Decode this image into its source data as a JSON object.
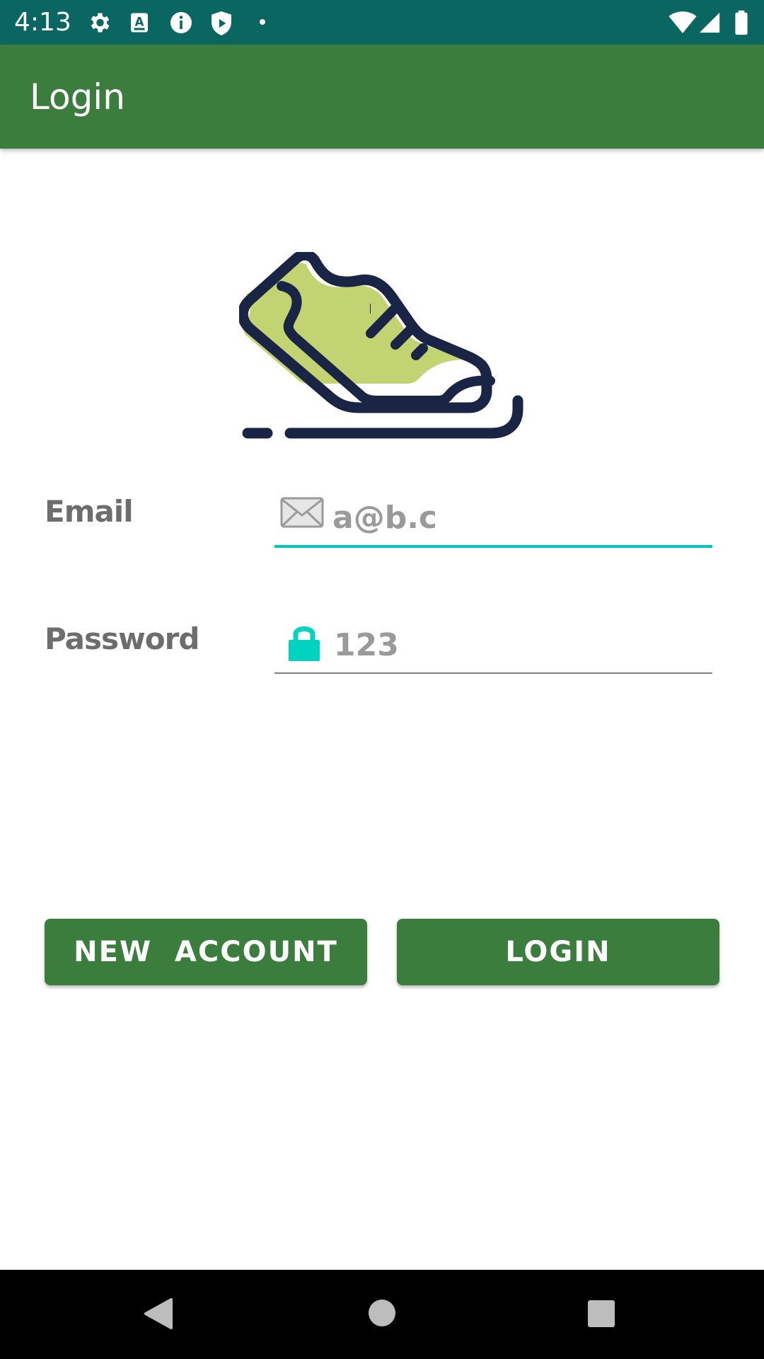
{
  "status_bar": {
    "time": "4:13",
    "background": "#0a6660",
    "left_icons": [
      "gear-icon",
      "translate-a-icon",
      "info-icon",
      "shield-play-icon",
      "dot-icon"
    ],
    "right_icons": [
      "wifi-icon",
      "cell-signal-icon",
      "battery-icon"
    ]
  },
  "app_bar": {
    "title": "Login",
    "background": "#3a7d3c"
  },
  "logo": {
    "icon": "sneaker-icon",
    "colors": {
      "outline": "#1a2545",
      "fill": "#c2d471"
    }
  },
  "form": {
    "email": {
      "label": "Email",
      "value": "a@b.c",
      "icon": "envelope-icon",
      "underline_color": "#00c4bd"
    },
    "password": {
      "label": "Password",
      "value": "123",
      "icon": "lock-icon",
      "icon_color": "#00d4c0",
      "underline_color": "#808080"
    }
  },
  "buttons": {
    "new_account": "NEW  ACCOUNT",
    "login": "LOGIN",
    "color": "#3a7d3c"
  },
  "nav_bar": {
    "buttons": [
      "back-icon",
      "home-icon",
      "recents-icon"
    ]
  }
}
